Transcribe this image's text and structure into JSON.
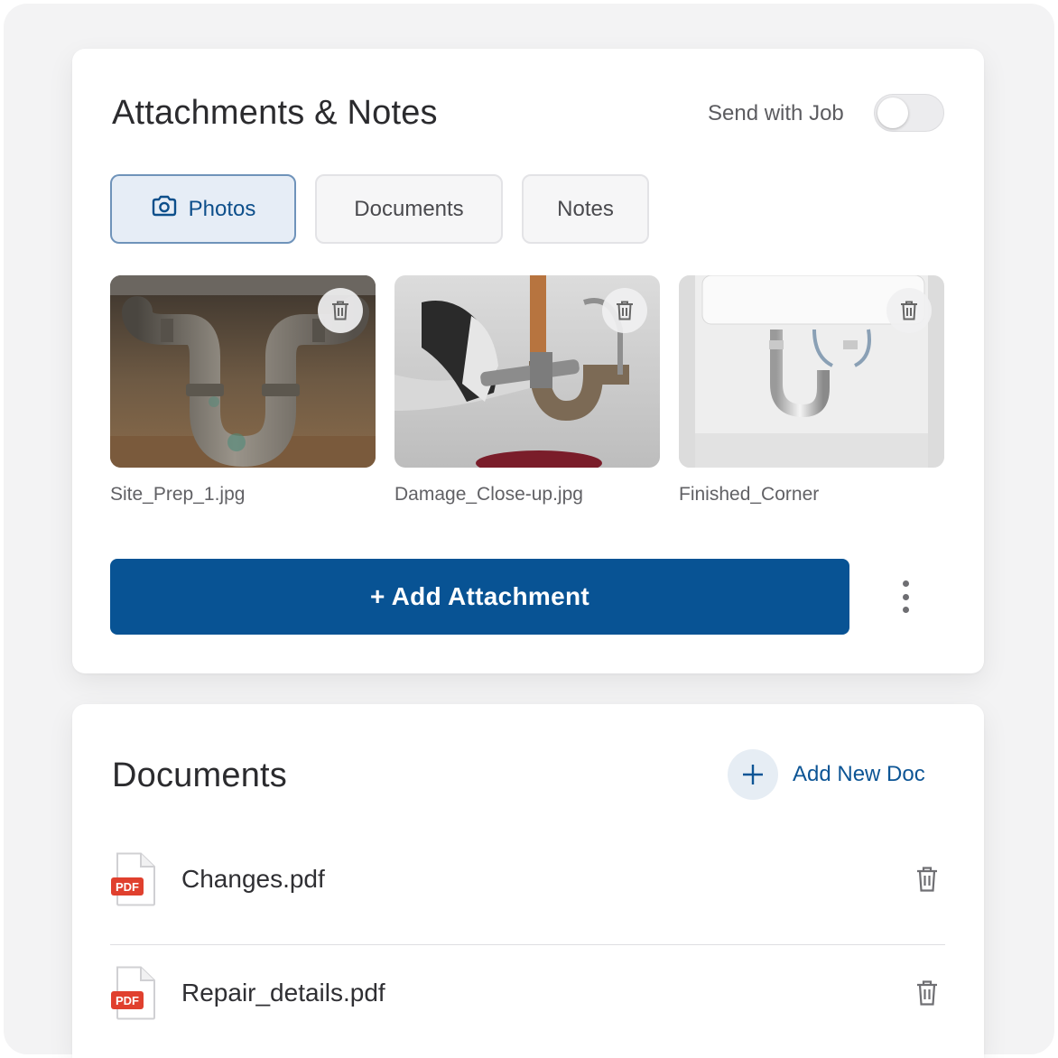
{
  "attachments": {
    "title": "Attachments & Notes",
    "send_with_job_label": "Send with Job",
    "send_with_job_on": false,
    "tabs": [
      {
        "label": "Photos",
        "icon": "camera-icon",
        "active": true
      },
      {
        "label": "Documents",
        "active": false
      },
      {
        "label": "Notes",
        "active": false
      }
    ],
    "photos": [
      {
        "filename": "Site_Prep_1.jpg",
        "subject": "corroded u-bend pipes"
      },
      {
        "filename": "Damage_Close-up.jpg",
        "subject": "gloved hand with wrench on pipe"
      },
      {
        "filename": "Finished_Corner",
        "subject": "new chrome pipes under sink"
      }
    ],
    "add_button_label": "+ Add Attachment",
    "more_icon": "more-vertical-icon"
  },
  "documents": {
    "title": "Documents",
    "add_label": "Add New Doc",
    "items": [
      {
        "name": "Changes.pdf",
        "badge": "PDF"
      },
      {
        "name": "Repair_details.pdf",
        "badge": "PDF"
      }
    ]
  },
  "colors": {
    "primary": "#085394",
    "active_tab_bg": "#e6edf6",
    "active_tab_border": "#6f93ba",
    "pdf_red": "#e0402e"
  }
}
